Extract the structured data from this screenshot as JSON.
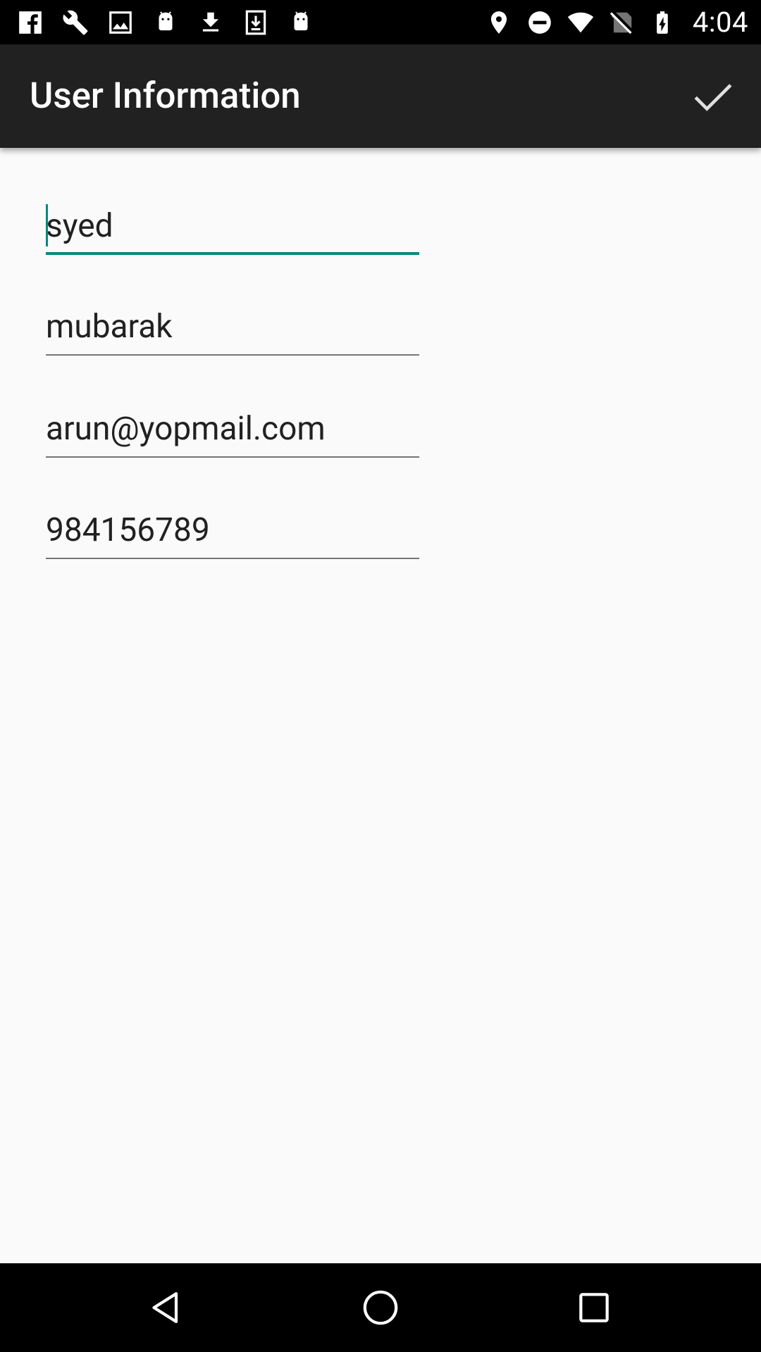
{
  "status_bar": {
    "time": "4:04",
    "left_icons": [
      "facebook-icon",
      "wrench-icon",
      "image-icon",
      "android-icon",
      "download-icon",
      "download-box-icon",
      "android-icon"
    ],
    "right_icons": [
      "location-icon",
      "do-not-disturb-icon",
      "wifi-icon",
      "no-sim-icon",
      "battery-charging-icon"
    ]
  },
  "app_bar": {
    "title": "User Information",
    "action_icon": "check-icon"
  },
  "form": {
    "first_name": "syed",
    "last_name": "mubarak",
    "email": "arun@yopmail.com",
    "phone": "984156789"
  },
  "colors": {
    "accent": "#00897b",
    "app_bar": "#212121",
    "background": "#fafafa"
  },
  "nav_bar": {
    "buttons": [
      "back-icon",
      "home-icon",
      "recents-icon"
    ]
  }
}
